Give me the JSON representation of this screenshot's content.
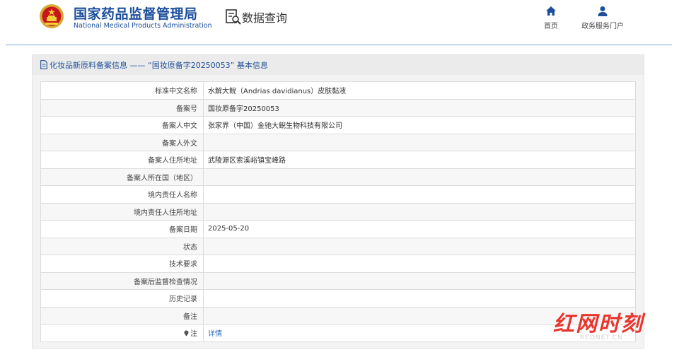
{
  "header": {
    "logo_icon": "national-emblem-icon",
    "brand_cn": "国家药品监督管理局",
    "brand_en": "National Medical Products Administration",
    "data_query_icon": "data-query-icon",
    "data_query_label": "数据查询",
    "nav": {
      "home_label": "首页",
      "home_icon": "home-icon",
      "portal_label": "政务服务门户",
      "portal_icon": "user-icon"
    },
    "accent_color": "#1c4e9c"
  },
  "panel": {
    "title": "化妆品新原料备案信息 —— “国妆原备字20250053” 基本信息",
    "title_icon": "document-icon",
    "rows": [
      {
        "label": "标准中文名称",
        "value": "水解大鲵（Andrias davidianus）皮肤黏液"
      },
      {
        "label": "备案号",
        "value": "国妆原备字20250053"
      },
      {
        "label": "备案人中文",
        "value": "张家界（中国）金驰大鲵生物科技有限公司"
      },
      {
        "label": "备案人外文",
        "value": ""
      },
      {
        "label": "备案人住所地址",
        "value": "武陵源区索溪峪镇宝峰路"
      },
      {
        "label": "备案人所在国（地区）",
        "value": ""
      },
      {
        "label": "境内责任人名称",
        "value": ""
      },
      {
        "label": "境内责任人住所地址",
        "value": ""
      },
      {
        "label": "备案日期",
        "value": "2025-05-20"
      },
      {
        "label": "状态",
        "value": ""
      },
      {
        "label": "技术要求",
        "value": ""
      },
      {
        "label": "备案后监督检查情况",
        "value": ""
      },
      {
        "label": "历史记录",
        "value": ""
      },
      {
        "label": "备注",
        "value": ""
      }
    ],
    "note_row": {
      "label": "注",
      "link": "详情",
      "icon": "pin-icon"
    }
  },
  "watermark": {
    "main": "红网时刻",
    "sub": "REDNET.CN",
    "color": "#e8352e"
  }
}
